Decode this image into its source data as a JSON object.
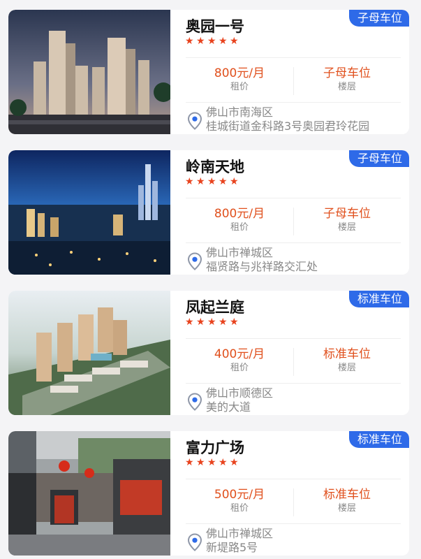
{
  "listings": [
    {
      "name": "奥园一号",
      "tag": "子母车位",
      "rating": 5,
      "price": "800元/月",
      "price_label": "租价",
      "floor": "子母车位",
      "floor_label": "楼层",
      "district": "佛山市南海区",
      "address": "桂城街道金科路3号奥园君玲花园",
      "icon": "location-pin-icon"
    },
    {
      "name": "岭南天地",
      "tag": "子母车位",
      "rating": 5,
      "price": "800元/月",
      "price_label": "租价",
      "floor": "子母车位",
      "floor_label": "楼层",
      "district": "佛山市禅城区",
      "address": "福贤路与兆祥路交汇处",
      "icon": "location-pin-icon"
    },
    {
      "name": "凤起兰庭",
      "tag": "标准车位",
      "rating": 5,
      "price": "400元/月",
      "price_label": "租价",
      "floor": "标准车位",
      "floor_label": "楼层",
      "district": "佛山市顺德区",
      "address": "美的大道",
      "icon": "location-pin-icon"
    },
    {
      "name": "富力广场",
      "tag": "标准车位",
      "rating": 5,
      "price": "500元/月",
      "price_label": "租价",
      "floor": "标准车位",
      "floor_label": "楼层",
      "district": "佛山市禅城区",
      "address": "新堤路5号",
      "icon": "location-pin-icon"
    }
  ],
  "colors": {
    "tag_bg": "#2e6ae8",
    "price": "#e0501d",
    "star": "#e8431e",
    "muted": "#888888",
    "page_bg": "#f4f4f6"
  }
}
